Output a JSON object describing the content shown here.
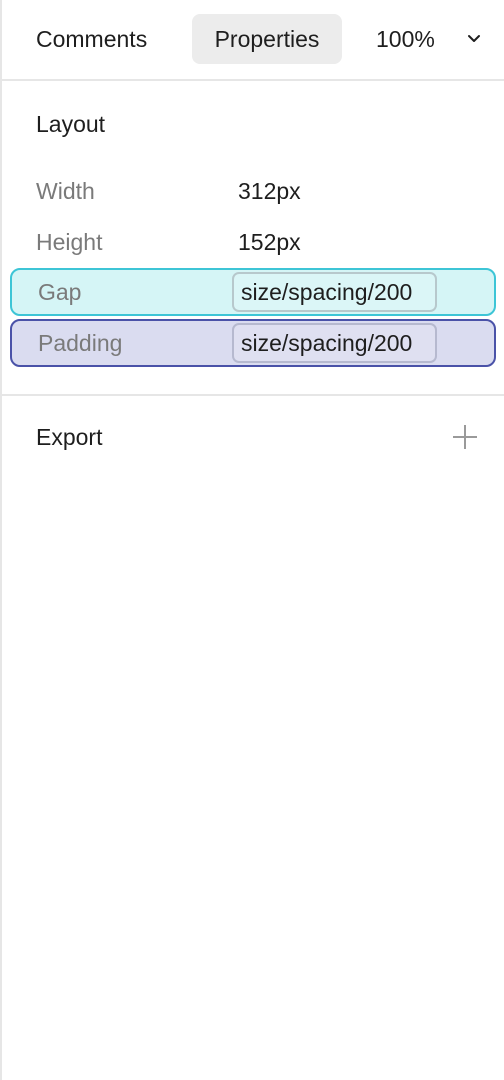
{
  "tabs": {
    "comments": "Comments",
    "properties": "Properties"
  },
  "zoom": {
    "value": "100%",
    "icon": "chevron-down-icon"
  },
  "layout": {
    "title": "Layout",
    "width": {
      "label": "Width",
      "value": "312px"
    },
    "height": {
      "label": "Height",
      "value": "152px"
    },
    "gap": {
      "label": "Gap",
      "token": "size/spacing/200"
    },
    "padding": {
      "label": "Padding",
      "token": "size/spacing/200"
    }
  },
  "export": {
    "title": "Export",
    "add_icon": "plus-icon"
  },
  "colors": {
    "gap_highlight_bg": "#d5f5f6",
    "gap_highlight_border": "#3dc5d6",
    "padding_highlight_bg": "#dadcf0",
    "padding_highlight_border": "#4a52a8",
    "active_tab_bg": "#ececec"
  }
}
